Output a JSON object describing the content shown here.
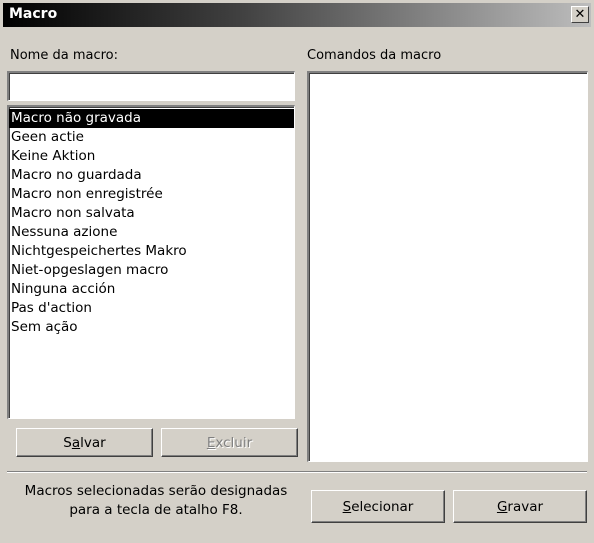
{
  "window": {
    "title": "Macro",
    "close_label": "✕"
  },
  "left": {
    "label": "Nome da macro:",
    "input_value": "",
    "items": [
      "Macro não gravada",
      "Geen actie",
      "Keine Aktion",
      "Macro no guardada",
      "Macro non enregistrée",
      "Macro non salvata",
      "Nessuna azione",
      "Nichtgespeichertes Makro",
      "Niet-opgeslagen macro",
      "Ninguna acción",
      "Pas d'action",
      "Sem ação"
    ],
    "selected_index": 0
  },
  "right": {
    "label": "Comandos da macro"
  },
  "buttons": {
    "save": {
      "pre": "S",
      "ul": "a",
      "post": "lvar"
    },
    "delete": {
      "pre": "",
      "ul": "E",
      "post": "xcluir"
    },
    "select": {
      "pre": "",
      "ul": "S",
      "post": "elecionar"
    },
    "record": {
      "pre": "",
      "ul": "G",
      "post": "ravar"
    }
  },
  "footer": {
    "line1": "Macros selecionadas serão designadas",
    "line2": "para a tecla de atalho F8."
  }
}
